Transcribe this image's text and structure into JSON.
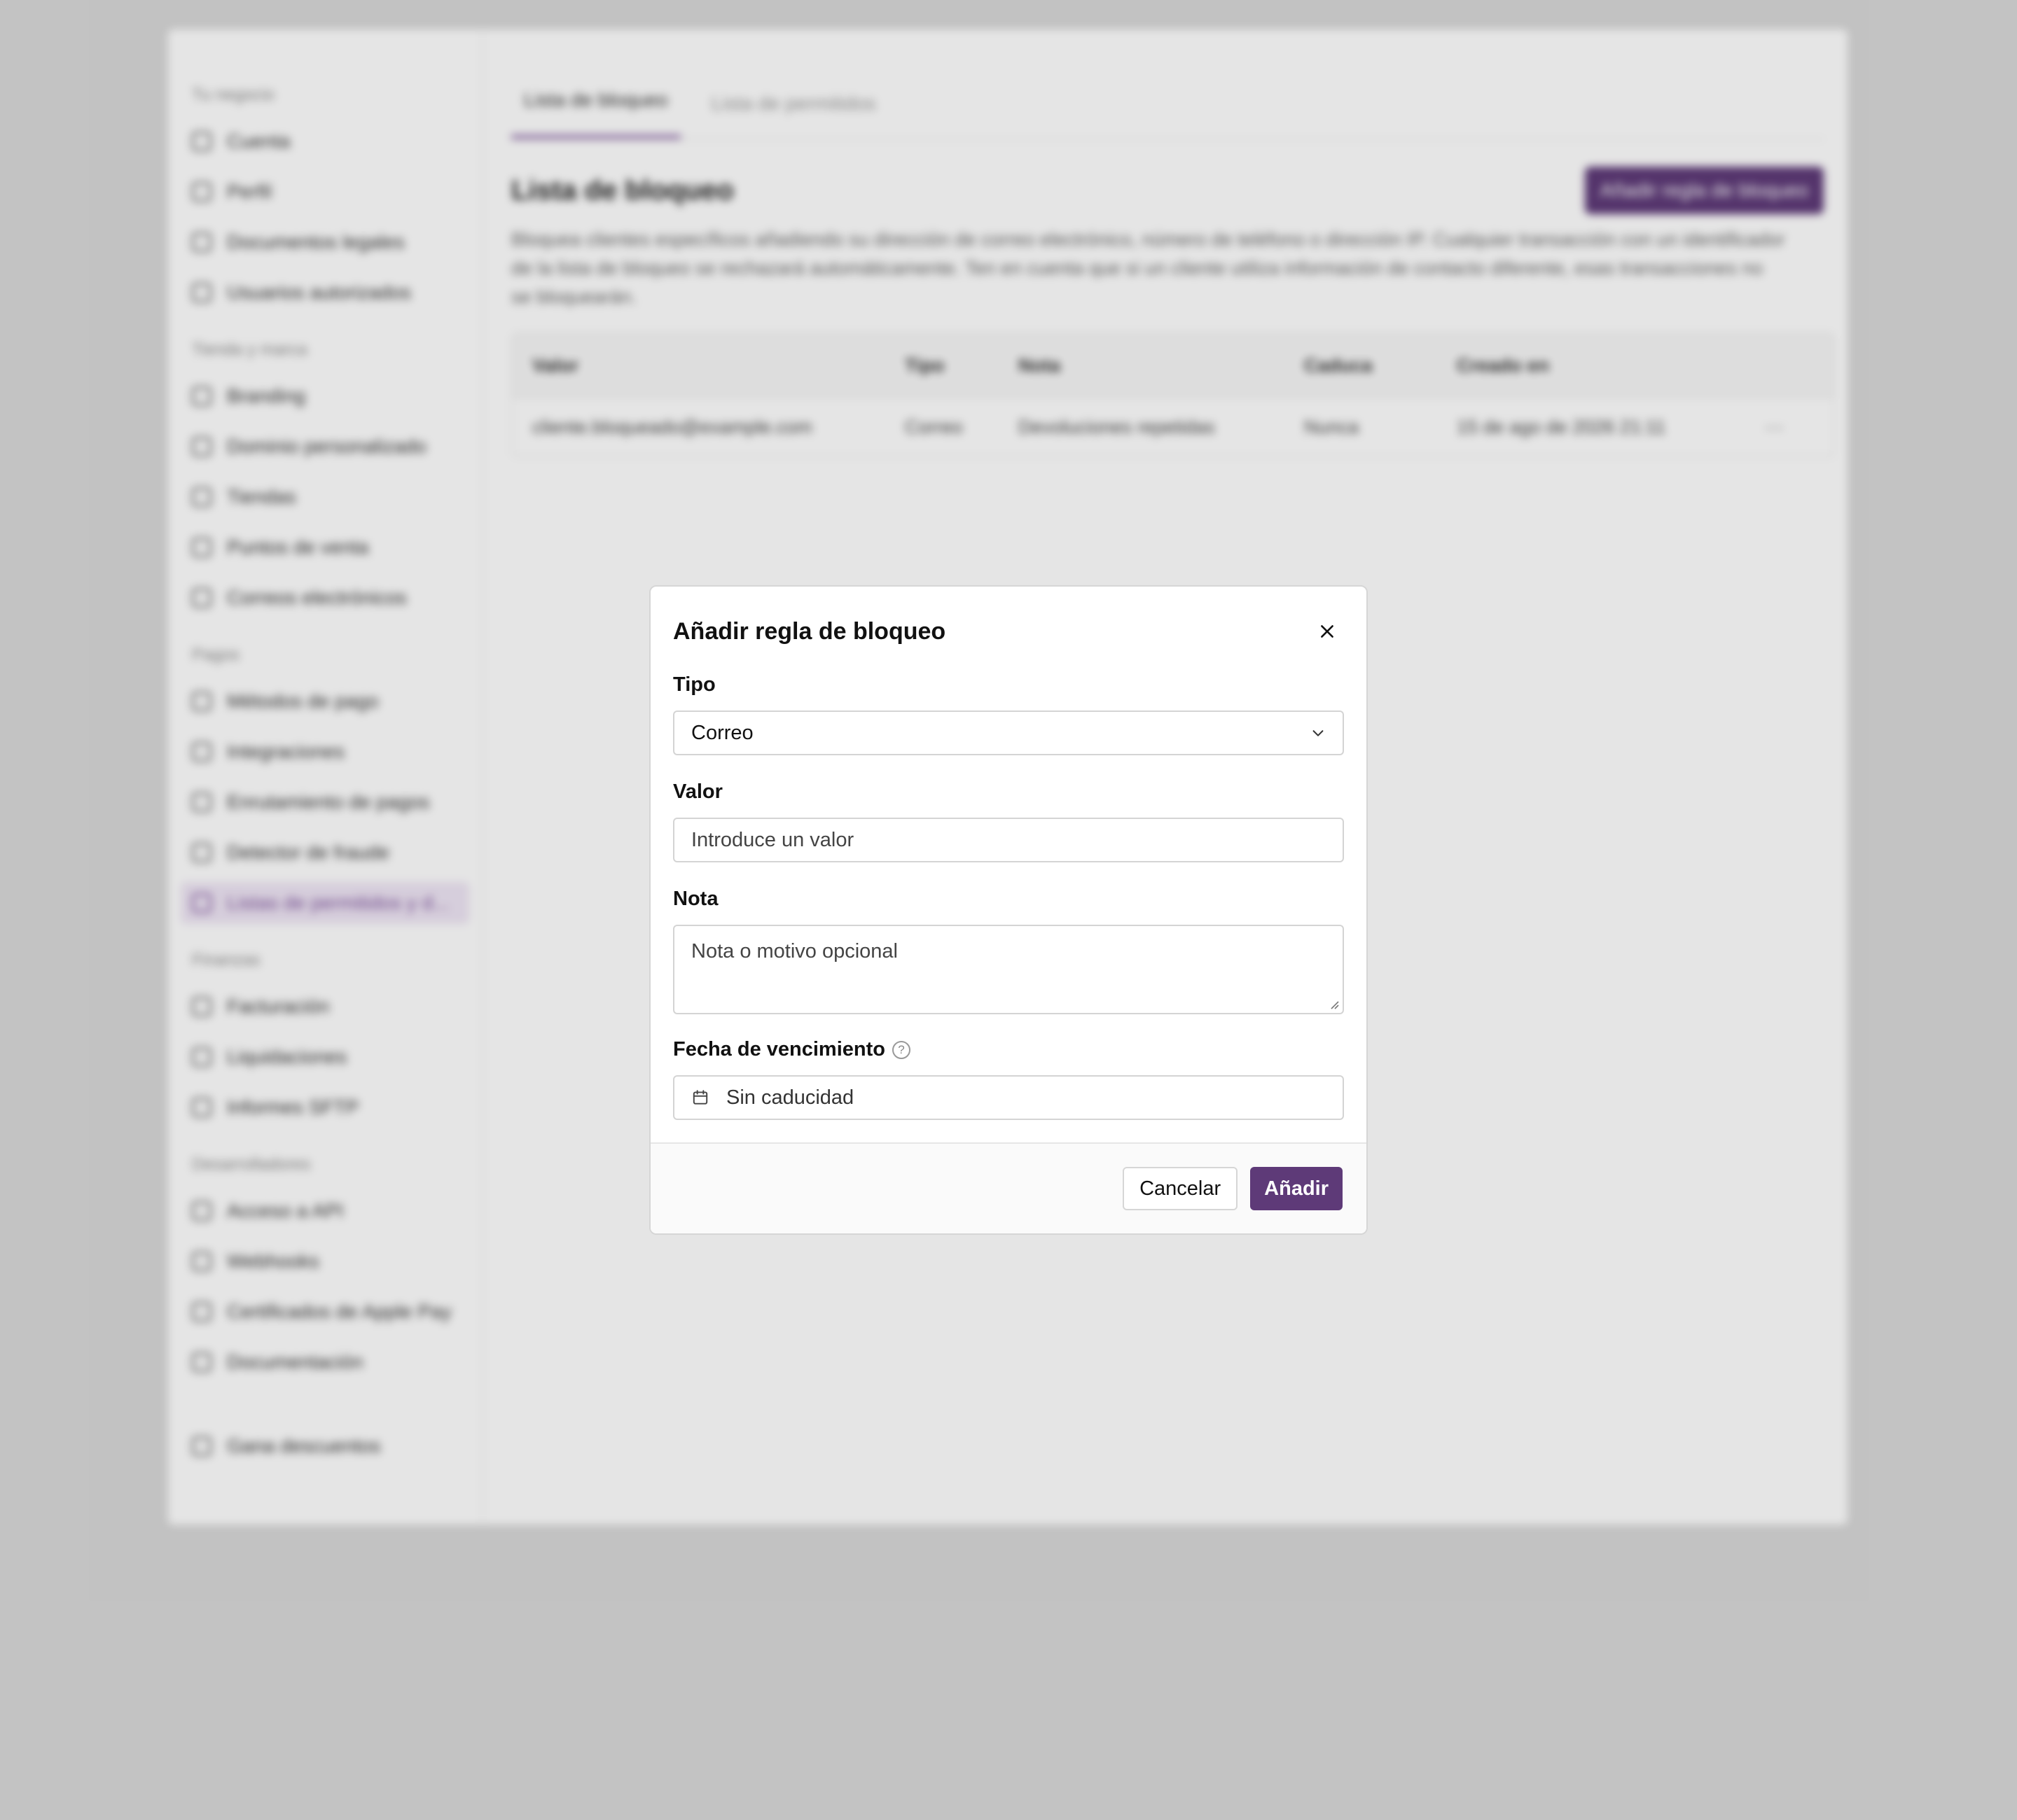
{
  "colors": {
    "accent": "#5e3a78",
    "overlay": "rgba(0,0,0,0.10)"
  },
  "sidebar": {
    "sections": [
      {
        "title": "Tu negocio",
        "items": [
          {
            "label": "Cuenta",
            "icon": "building-icon"
          },
          {
            "label": "Perfil",
            "icon": "user-icon"
          },
          {
            "label": "Documentos legales",
            "icon": "document-icon"
          },
          {
            "label": "Usuarios autorizados",
            "icon": "users-icon"
          }
        ]
      },
      {
        "title": "Tienda y marca",
        "items": [
          {
            "label": "Branding",
            "icon": "brush-icon"
          },
          {
            "label": "Dominio personalizado",
            "icon": "globe-icon"
          },
          {
            "label": "Tiendas",
            "icon": "store-icon"
          },
          {
            "label": "Puntos de venta",
            "icon": "phone-icon"
          },
          {
            "label": "Correos electrónicos",
            "icon": "mail-icon"
          }
        ]
      },
      {
        "title": "Pagos",
        "items": [
          {
            "label": "Métodos de pago",
            "icon": "card-icon"
          },
          {
            "label": "Integraciones",
            "icon": "grid-icon"
          },
          {
            "label": "Enrutamiento de pagos",
            "icon": "route-icon"
          },
          {
            "label": "Detector de fraude",
            "icon": "shield-icon"
          },
          {
            "label": "Listas de permitidos y d...",
            "icon": "list-icon",
            "active": true
          }
        ]
      },
      {
        "title": "Finanzas",
        "items": [
          {
            "label": "Facturación",
            "icon": "invoice-icon"
          },
          {
            "label": "Liquidaciones",
            "icon": "bank-icon"
          },
          {
            "label": "Informes SFTP",
            "icon": "sync-icon"
          }
        ]
      },
      {
        "title": "Desarrolladores",
        "items": [
          {
            "label": "Acceso a API",
            "icon": "key-icon"
          },
          {
            "label": "Webhooks",
            "icon": "webhook-icon"
          },
          {
            "label": "Certificados de Apple Pay",
            "icon": "certificate-icon"
          },
          {
            "label": "Documentación",
            "icon": "code-icon"
          }
        ]
      }
    ],
    "footer_item": {
      "label": "Gana descuentos",
      "icon": "gift-icon"
    }
  },
  "main": {
    "tabs": [
      {
        "label": "Lista de bloqueo",
        "active": true
      },
      {
        "label": "Lista de permitidos",
        "active": false
      }
    ],
    "title": "Lista de bloqueo",
    "add_button": "Añadir regla de bloqueo",
    "description": "Bloquea clientes específicos añadiendo su dirección de correo electrónico, número de teléfono o dirección IP. Cualquier transacción con un identificador de la lista de bloqueo se rechazará automáticamente. Ten en cuenta que si un cliente utiliza información de contacto diferente, esas transacciones no se bloquearán.",
    "table": {
      "headers": [
        "Valor",
        "Tipo",
        "Nota",
        "Caduca",
        "Creado en",
        ""
      ],
      "rows": [
        [
          "cliente.bloqueado@example.com",
          "Correo",
          "Devoluciones repetidas",
          "Nunca",
          "15 de ago de 2026 21:11",
          "···"
        ]
      ]
    }
  },
  "modal": {
    "title": "Añadir regla de bloqueo",
    "close_icon": "close-icon",
    "fields": {
      "type": {
        "label": "Tipo",
        "value": "Correo"
      },
      "value": {
        "label": "Valor",
        "placeholder": "Introduce un valor"
      },
      "note": {
        "label": "Nota",
        "placeholder": "Nota o motivo opcional"
      },
      "expiry": {
        "label": "Fecha de vencimiento",
        "help": "?",
        "value": "Sin caducidad"
      }
    },
    "cancel_label": "Cancelar",
    "submit_label": "Añadir"
  }
}
